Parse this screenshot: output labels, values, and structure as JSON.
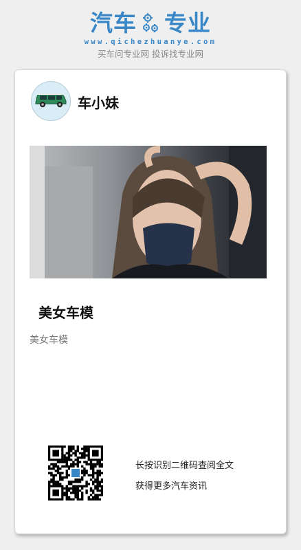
{
  "header": {
    "brand_left": "汽车",
    "brand_right": "专业",
    "url": "www.qichezhuanye.com",
    "slogan": "买车问专业网 投诉找专业网",
    "brand_color": "#3a87c8"
  },
  "card": {
    "author_name": "车小妹",
    "avatar_icon": "car-icon",
    "article_title": "美女车模",
    "article_description": "美女车模",
    "qr_icon": "qr-code-icon",
    "qr_caption_line1": "长按识别二维码查阅全文",
    "qr_caption_line2": "获得更多汽车资讯"
  }
}
